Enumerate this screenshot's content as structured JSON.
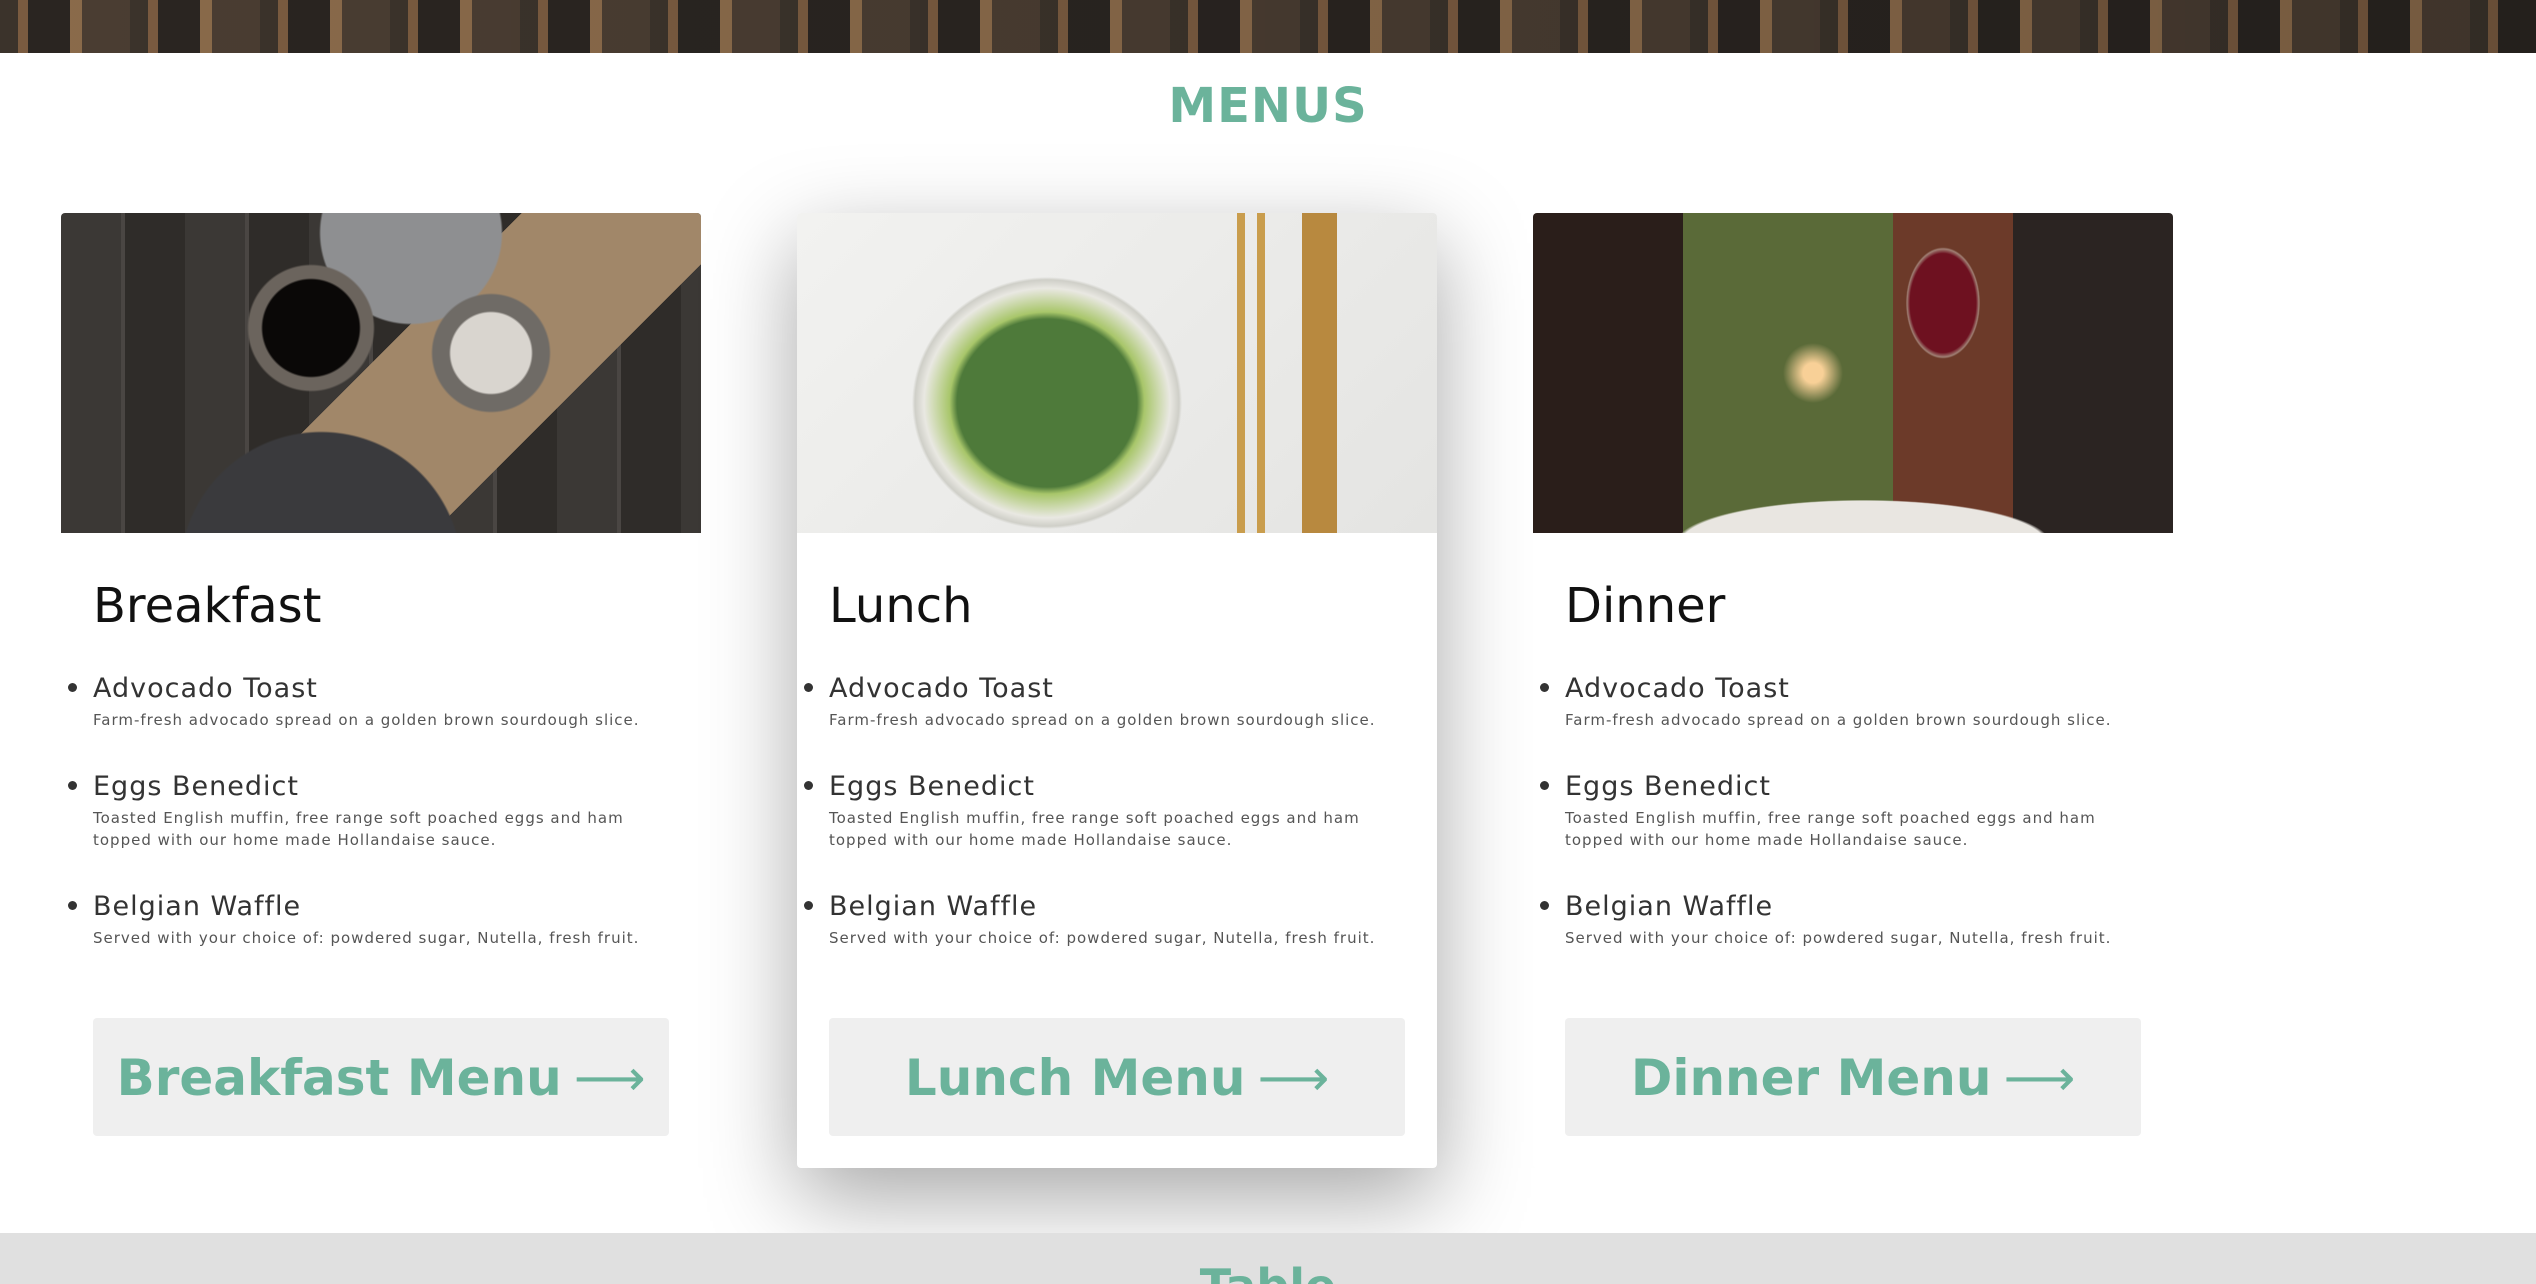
{
  "section": {
    "title": "MENUS"
  },
  "cards": [
    {
      "heading": "Breakfast",
      "image_alt": "breakfast table with coffee and toast",
      "items": [
        {
          "name": "Advocado Toast",
          "desc": "Farm-fresh advocado spread on a golden brown sourdough slice."
        },
        {
          "name": "Eggs Benedict",
          "desc": "Toasted English muffin, free range soft poached eggs and ham topped with our home made Hollandaise sauce."
        },
        {
          "name": "Belgian Waffle",
          "desc": "Served with your choice of: powdered sugar, Nutella, fresh fruit."
        }
      ],
      "button_label": "Breakfast Menu",
      "button_arrow": "⟶"
    },
    {
      "heading": "Lunch",
      "image_alt": "salad bowl with golden cutlery",
      "items": [
        {
          "name": "Advocado Toast",
          "desc": "Farm-fresh advocado spread on a golden brown sourdough slice."
        },
        {
          "name": "Eggs Benedict",
          "desc": "Toasted English muffin, free range soft poached eggs and ham topped with our home made Hollandaise sauce."
        },
        {
          "name": "Belgian Waffle",
          "desc": "Served with your choice of: powdered sugar, Nutella, fresh fruit."
        }
      ],
      "button_label": "Lunch Menu",
      "button_arrow": "⟶"
    },
    {
      "heading": "Dinner",
      "image_alt": "red wine glass and dinner plate",
      "items": [
        {
          "name": "Advocado Toast",
          "desc": "Farm-fresh advocado spread on a golden brown sourdough slice."
        },
        {
          "name": "Eggs Benedict",
          "desc": "Toasted English muffin, free range soft poached eggs and ham topped with our home made Hollandaise sauce."
        },
        {
          "name": "Belgian Waffle",
          "desc": "Served with your choice of: powdered sugar, Nutella, fresh fruit."
        }
      ],
      "button_label": "Dinner Menu",
      "button_arrow": "⟶"
    }
  ],
  "footer": {
    "title": "Table"
  },
  "colors": {
    "accent": "#6bb39b",
    "button_bg": "#efefef",
    "footer_bg": "#e0e0e0"
  }
}
